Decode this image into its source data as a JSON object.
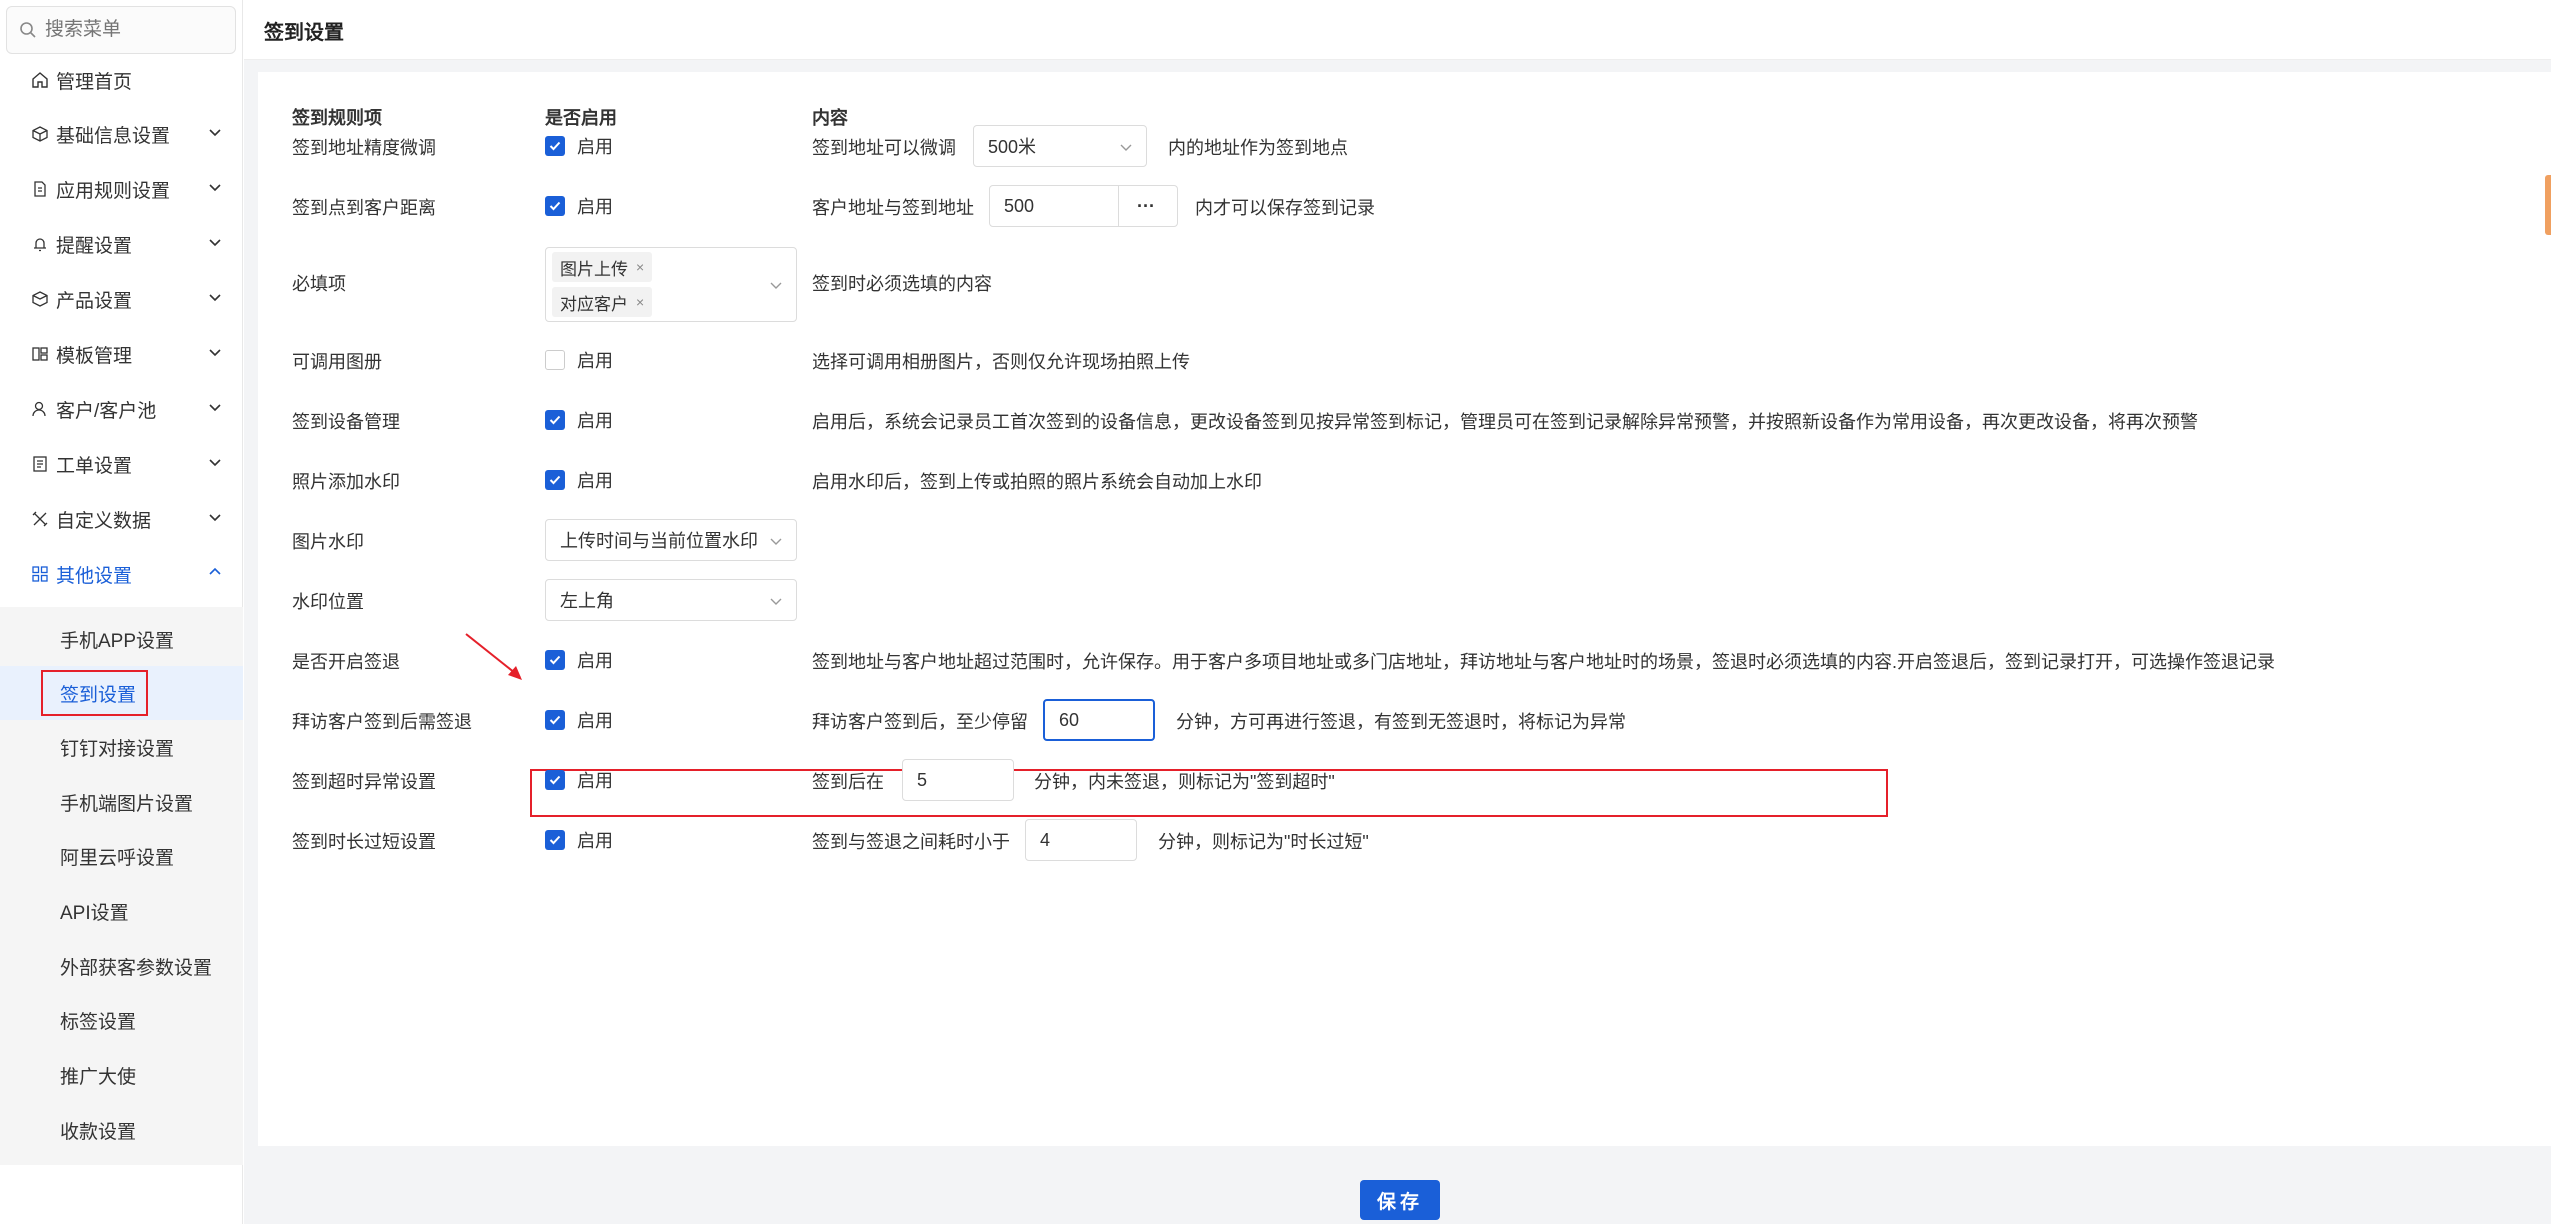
{
  "sidebar": {
    "search_placeholder": "搜索菜单",
    "items": [
      {
        "label": "管理首页",
        "icon": "home-icon"
      },
      {
        "label": "基础信息设置",
        "icon": "cube-icon"
      },
      {
        "label": "应用规则设置",
        "icon": "document-icon"
      },
      {
        "label": "提醒设置",
        "icon": "bell-icon"
      },
      {
        "label": "产品设置",
        "icon": "box-icon"
      },
      {
        "label": "模板管理",
        "icon": "template-icon"
      },
      {
        "label": "客户/客户池",
        "icon": "user-icon"
      },
      {
        "label": "工单设置",
        "icon": "ticket-icon"
      },
      {
        "label": "自定义数据",
        "icon": "tools-icon"
      },
      {
        "label": "其他设置",
        "icon": "grid-icon"
      }
    ],
    "sub_items": [
      "手机APP设置",
      "签到设置",
      "钉钉对接设置",
      "手机端图片设置",
      "阿里云呼设置",
      "API设置",
      "外部获客参数设置",
      "标签设置",
      "推广大使",
      "收款设置"
    ],
    "selected_sub": "签到设置"
  },
  "header": {
    "title": "签到设置"
  },
  "table": {
    "headers": {
      "rule": "签到规则项",
      "enabled": "是否启用",
      "content": "内容"
    },
    "enable_label": "启用",
    "rows": {
      "accuracy": {
        "label": "签到地址精度微调",
        "pre": "签到地址可以微调",
        "select": "500米",
        "post": "内的地址作为签到地点"
      },
      "distance": {
        "label": "签到点到客户距离",
        "pre": "客户地址与签到地址",
        "value": "500",
        "more": "···",
        "post": "内才可以保存签到记录"
      },
      "required": {
        "label": "必填项",
        "tags": [
          "图片上传",
          "对应客户"
        ],
        "tag_close": "×",
        "desc": "签到时必须选填的内容"
      },
      "album": {
        "label": "可调用图册",
        "desc": "选择可调用相册图片，否则仅允许现场拍照上传"
      },
      "device": {
        "label": "签到设备管理",
        "desc": "启用后，系统会记录员工首次签到的设备信息，更改设备签到见按异常签到标记，管理员可在签到记录解除异常预警，并按照新设备作为常用设备，再次更改设备，将再次预警"
      },
      "watermark": {
        "label": "照片添加水印",
        "desc": "启用水印后，签到上传或拍照的照片系统会自动加上水印"
      },
      "wm_type": {
        "label": "图片水印",
        "select": "上传时间与当前位置水印"
      },
      "wm_pos": {
        "label": "水印位置",
        "select": "左上角"
      },
      "checkout": {
        "label": "是否开启签退",
        "desc": "签到地址与客户地址超过范围时，允许保存。用于客户多项目地址或多门店地址，拜访地址与客户地址时的场景，签退时必须选填的内容.开启签退后，签到记录打开，可选操作签退记录"
      },
      "visit": {
        "label": "拜访客户签到后需签退",
        "pre": "拜访客户签到后，至少停留",
        "value": "60",
        "post": "分钟，方可再进行签退，有签到无签退时，将标记为异常"
      },
      "timeout": {
        "label": "签到超时异常设置",
        "pre": "签到后在",
        "value": "5",
        "post": "分钟，内未签退，则标记为\"签到超时\""
      },
      "short": {
        "label": "签到时长过短设置",
        "pre": "签到与签退之间耗时小于",
        "value": "4",
        "post": "分钟，则标记为\"时长过短\""
      }
    }
  },
  "save_label": "保存",
  "colors": {
    "primary": "#1a5fd8",
    "highlight": "#e5202a"
  }
}
